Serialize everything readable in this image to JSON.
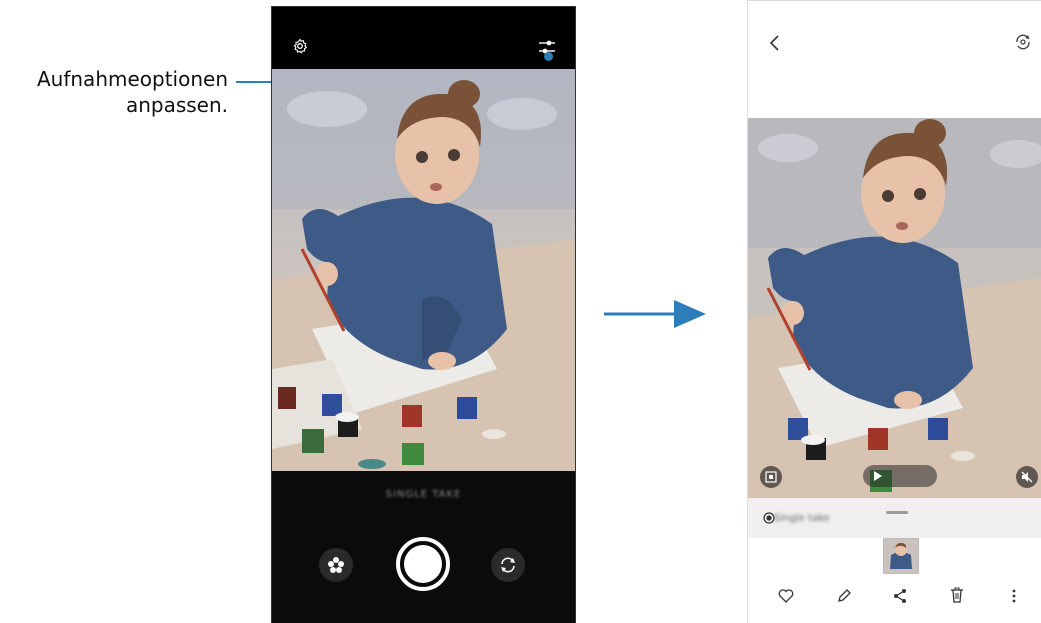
{
  "callout": {
    "line1": "Aufnahmeoptionen",
    "line2": "anpassen."
  },
  "camera_screen": {
    "mode_label": "SINGLE TAKE",
    "icons": [
      "settings-gear-icon",
      "adjust-options-icon",
      "flower-filter-icon",
      "shutter-button",
      "switch-camera-icon"
    ]
  },
  "viewer_screen": {
    "selected_label": "Single take",
    "play_label": "",
    "icons": [
      "back-chevron-icon",
      "rotate-camera-icon",
      "portrait-frame-icon",
      "play-icon",
      "mute-icon",
      "heart-icon",
      "edit-pencil-icon",
      "share-icon",
      "trash-icon",
      "more-vert-icon"
    ]
  },
  "colors": {
    "accent": "#2d7eb8",
    "camera_bg": "#0b0b0b",
    "sheet_bg": "#f0eeee"
  }
}
